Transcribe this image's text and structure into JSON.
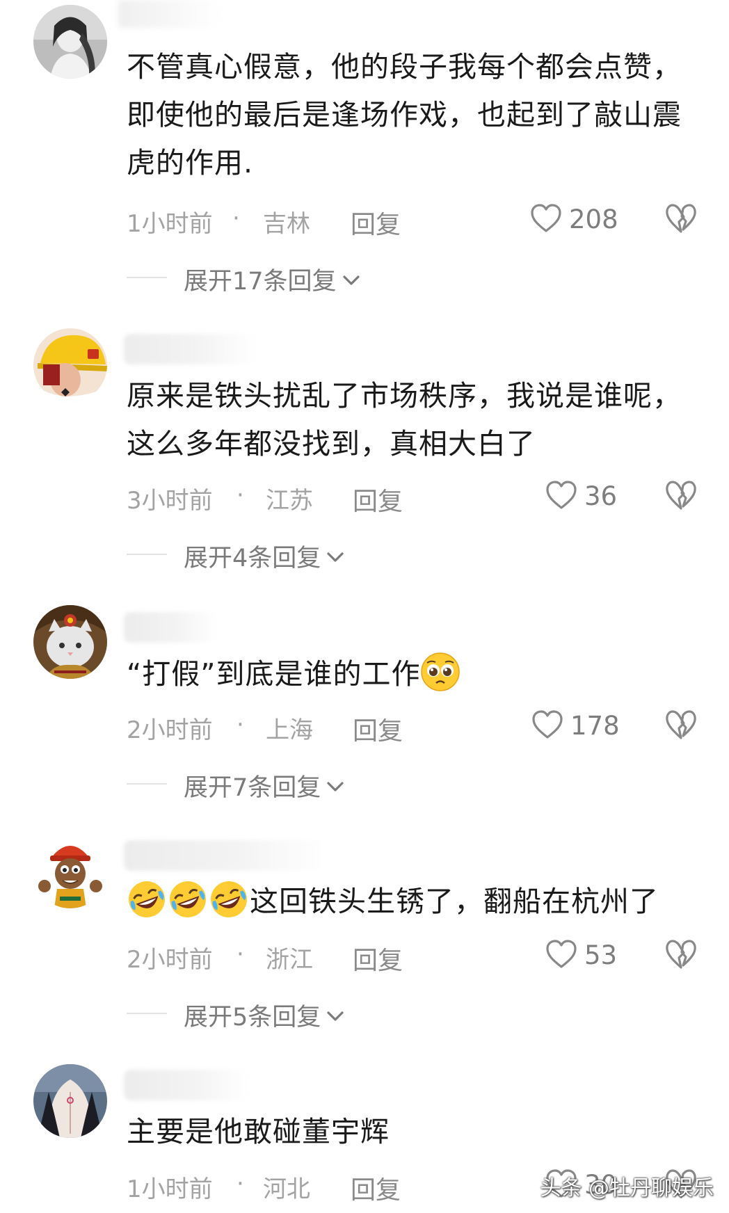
{
  "comments": [
    {
      "text": "不管真心假意，他的段子我每个都会点赞，即使他的最后是逢场作戏，也起到了敲山震虎的作用.",
      "time": "1小时前",
      "separator": "·",
      "location": "吉林",
      "reply": "回复",
      "likes": "208",
      "expand": "展开17条回复"
    },
    {
      "text": "原来是铁头扰乱了市场秩序，我说是谁呢，这么多年都没找到，真相大白了",
      "time": "3小时前",
      "separator": "·",
      "location": "江苏",
      "reply": "回复",
      "likes": "36",
      "expand": "展开4条回复"
    },
    {
      "text": "“打假”到底是谁的工作",
      "time": "2小时前",
      "separator": "·",
      "location": "上海",
      "reply": "回复",
      "likes": "178",
      "expand": "展开7条回复"
    },
    {
      "text": "这回铁头生锈了，翻船在杭州了",
      "time": "2小时前",
      "separator": "·",
      "location": "浙江",
      "reply": "回复",
      "likes": "53",
      "expand": "展开5条回复"
    },
    {
      "text": "主要是他敢碰董宇辉",
      "time": "1小时前",
      "separator": "·",
      "location": "河北",
      "reply": "回复",
      "likes": "30"
    }
  ],
  "icons": {
    "like": "heart-outline-icon",
    "dislike": "broken-heart-icon",
    "expand": "chevron-down-icon",
    "emoji_pleading": "pleading-face-emoji",
    "emoji_laugh": "rolling-laughing-emoji"
  },
  "watermark": "头条 @牡丹聊娱乐",
  "colors": {
    "text": "#1a1a1a",
    "meta": "#a3a3a3",
    "reply": "#8a8a8a",
    "expand": "#7a7a7a",
    "icon": "#888888"
  }
}
